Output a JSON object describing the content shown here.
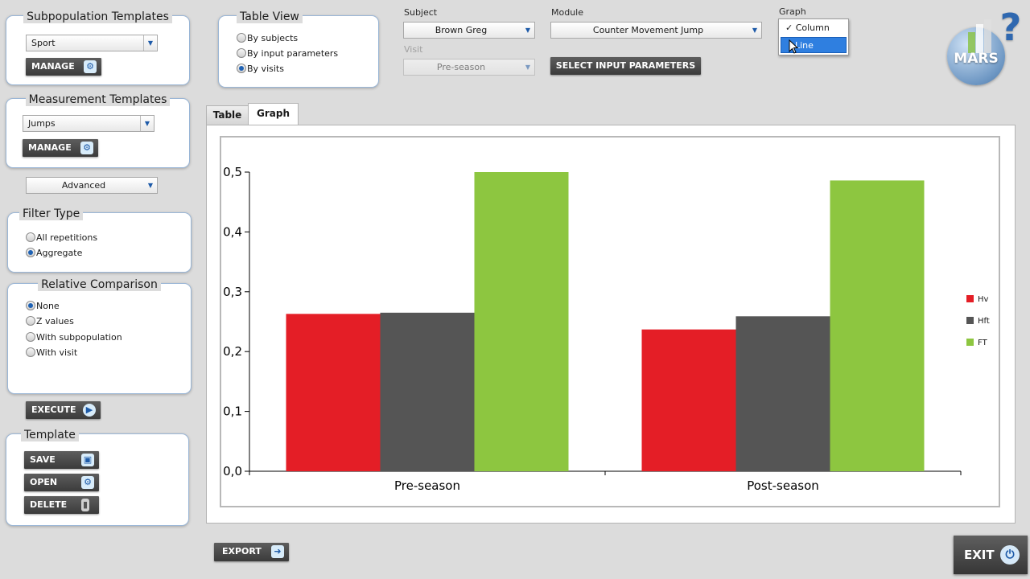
{
  "subpopulation": {
    "title": "Subpopulation Templates",
    "selected": "Sport",
    "manage_label": "MANAGE"
  },
  "measurement": {
    "title": "Measurement Templates",
    "selected": "Jumps",
    "manage_label": "MANAGE"
  },
  "advanced": {
    "selected": "Advanced"
  },
  "filter_type": {
    "title": "Filter Type",
    "options": [
      {
        "label": "All repetitions",
        "selected": false
      },
      {
        "label": "Aggregate",
        "selected": true
      }
    ]
  },
  "relative_comparison": {
    "title": "Relative Comparison",
    "options": [
      {
        "label": "None",
        "selected": true
      },
      {
        "label": "Z values",
        "selected": false
      },
      {
        "label": "With subpopulation",
        "selected": false
      },
      {
        "label": "With visit",
        "selected": false
      }
    ]
  },
  "execute_label": "EXECUTE",
  "template": {
    "title": "Template",
    "save_label": "SAVE",
    "open_label": "OPEN",
    "delete_label": "DELETE"
  },
  "table_view": {
    "title": "Table View",
    "options": [
      {
        "label": "By subjects",
        "selected": false
      },
      {
        "label": "By input parameters",
        "selected": false
      },
      {
        "label": "By visits",
        "selected": true
      }
    ]
  },
  "subject": {
    "label": "Subject",
    "selected": "Brown Greg"
  },
  "visit": {
    "label": "Visit",
    "selected": "Pre-season",
    "disabled": true
  },
  "module": {
    "label": "Module",
    "selected": "Counter Movement Jump"
  },
  "select_params_label": "SELECT INPUT PARAMETERS",
  "graph_menu": {
    "label": "Graph",
    "items": [
      {
        "label": "Column",
        "checked": true,
        "highlighted": false
      },
      {
        "label": "Line",
        "checked": false,
        "highlighted": true
      }
    ]
  },
  "logo": {
    "text": "MARS",
    "help_glyph": "?"
  },
  "tabs": [
    {
      "label": "Table",
      "active": false
    },
    {
      "label": "Graph",
      "active": true
    }
  ],
  "export_label": "EXPORT",
  "exit_label": "EXIT",
  "colors": {
    "accent": "#1f62b4",
    "highlight": "#2f7fe0",
    "hv": "#e41e26",
    "hft": "#555555",
    "ft": "#8dc640"
  },
  "icons": {
    "manage": "gear-icon",
    "execute": "play-icon",
    "save": "floppy-disk-icon",
    "open": "gear-icon",
    "delete": "trash-icon",
    "export": "export-icon",
    "exit": "power-icon",
    "dropdown": "chevron-down-icon"
  },
  "chart_data": {
    "type": "bar",
    "categories": [
      "Pre-season",
      "Post-season"
    ],
    "series": [
      {
        "name": "Hv",
        "color": "#e41e26",
        "values": [
          0.263,
          0.237
        ]
      },
      {
        "name": "Hft",
        "color": "#555555",
        "values": [
          0.265,
          0.259
        ]
      },
      {
        "name": "FT",
        "color": "#8dc640",
        "values": [
          0.5,
          0.486
        ]
      }
    ],
    "ylim": [
      0,
      0.5
    ],
    "yticks": [
      "0,0",
      "0,1",
      "0,2",
      "0,3",
      "0,4",
      "0,5"
    ],
    "title": "",
    "xlabel": "",
    "ylabel": "",
    "legend_position": "right",
    "grid": false
  }
}
